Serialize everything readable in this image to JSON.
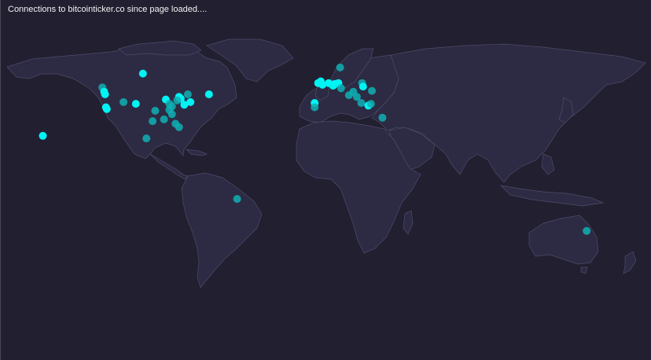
{
  "header": {
    "title": "Connections to bitcointicker.co since page loaded...."
  },
  "colors": {
    "background": "#211f30",
    "land": "#2d2b43",
    "border": "#4e4b6a",
    "dot_bright": "#00f4f4",
    "dot_dim": "#0fb0b4"
  },
  "connections": [
    {
      "lat": 57.0,
      "lon": -101.0,
      "bright": true
    },
    {
      "lat": 49.0,
      "lon": -124.0,
      "bright": false
    },
    {
      "lat": 46.5,
      "lon": -123.0,
      "bright": true
    },
    {
      "lat": 45.0,
      "lon": -122.5,
      "bright": true
    },
    {
      "lat": 37.5,
      "lon": -122.0,
      "bright": true
    },
    {
      "lat": 36.5,
      "lon": -121.5,
      "bright": true
    },
    {
      "lat": 40.5,
      "lon": -112.0,
      "bright": false
    },
    {
      "lat": 39.5,
      "lon": -105.0,
      "bright": true
    },
    {
      "lat": 42.0,
      "lon": -88.0,
      "bright": true
    },
    {
      "lat": 43.5,
      "lon": -80.5,
      "bright": true
    },
    {
      "lat": 42.5,
      "lon": -79.5,
      "bright": true
    },
    {
      "lat": 45.0,
      "lon": -75.5,
      "bright": false
    },
    {
      "lat": 40.5,
      "lon": -74.0,
      "bright": true
    },
    {
      "lat": 39.0,
      "lon": -77.5,
      "bright": true
    },
    {
      "lat": 41.5,
      "lon": -81.5,
      "bright": false
    },
    {
      "lat": 39.5,
      "lon": -86.0,
      "bright": false
    },
    {
      "lat": 38.0,
      "lon": -84.5,
      "bright": false
    },
    {
      "lat": 36.0,
      "lon": -86.0,
      "bright": false
    },
    {
      "lat": 35.5,
      "lon": -94.0,
      "bright": false
    },
    {
      "lat": 33.5,
      "lon": -84.5,
      "bright": false
    },
    {
      "lat": 29.5,
      "lon": -95.5,
      "bright": false
    },
    {
      "lat": 30.5,
      "lon": -89.0,
      "bright": false
    },
    {
      "lat": 28.0,
      "lon": -82.5,
      "bright": false
    },
    {
      "lat": 26.0,
      "lon": -80.5,
      "bright": false
    },
    {
      "lat": 45.0,
      "lon": -63.5,
      "bright": true
    },
    {
      "lat": 19.5,
      "lon": -99.0,
      "bright": false
    },
    {
      "lat": 21.0,
      "lon": -157.8,
      "bright": true
    },
    {
      "lat": -15.5,
      "lon": -47.5,
      "bright": false
    },
    {
      "lat": 60.5,
      "lon": 11.0,
      "bright": false
    },
    {
      "lat": 52.5,
      "lon": 0.0,
      "bright": true
    },
    {
      "lat": 51.5,
      "lon": -1.5,
      "bright": true
    },
    {
      "lat": 50.5,
      "lon": 1.0,
      "bright": true
    },
    {
      "lat": 51.5,
      "lon": 4.5,
      "bright": true
    },
    {
      "lat": 51.0,
      "lon": 8.0,
      "bright": true
    },
    {
      "lat": 51.5,
      "lon": 10.0,
      "bright": true
    },
    {
      "lat": 50.0,
      "lon": 7.0,
      "bright": true
    },
    {
      "lat": 48.5,
      "lon": 11.5,
      "bright": false
    },
    {
      "lat": 46.5,
      "lon": 18.5,
      "bright": false
    },
    {
      "lat": 51.5,
      "lon": 23.5,
      "bright": false
    },
    {
      "lat": 49.5,
      "lon": 24.0,
      "bright": true
    },
    {
      "lat": 47.0,
      "lon": 29.0,
      "bright": false
    },
    {
      "lat": 44.5,
      "lon": 16.0,
      "bright": false
    },
    {
      "lat": 43.5,
      "lon": 20.5,
      "bright": false
    },
    {
      "lat": 40.0,
      "lon": 23.0,
      "bright": false
    },
    {
      "lat": 38.5,
      "lon": 27.0,
      "bright": true
    },
    {
      "lat": 39.5,
      "lon": 28.5,
      "bright": false
    },
    {
      "lat": 40.0,
      "lon": -3.5,
      "bright": true
    },
    {
      "lat": 37.5,
      "lon": -3.5,
      "bright": false
    },
    {
      "lat": 31.5,
      "lon": 35.0,
      "bright": false
    },
    {
      "lat": -34.0,
      "lon": 151.0,
      "bright": false
    }
  ]
}
